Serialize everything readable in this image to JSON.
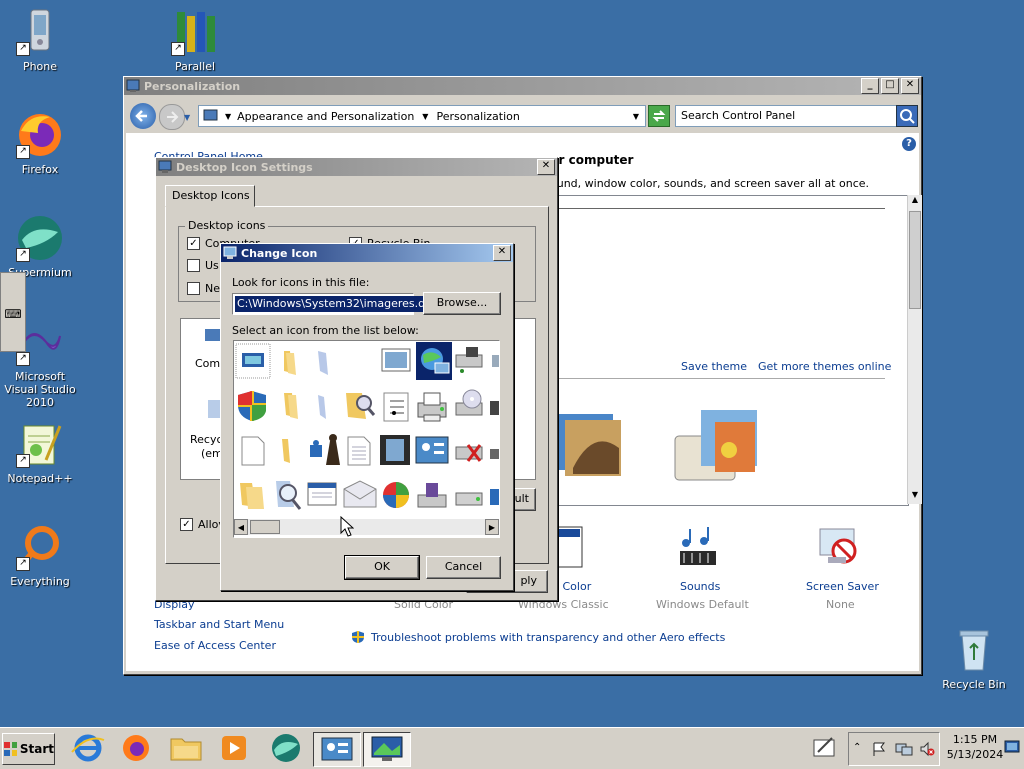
{
  "desktop": {
    "icons": [
      {
        "label": "Phone",
        "icon": "phone-icon"
      },
      {
        "label": "Parallel",
        "icon": "parallel-icon"
      },
      {
        "label": "Firefox",
        "icon": "firefox-icon"
      },
      {
        "label": "Supermium",
        "icon": "supermium-icon"
      },
      {
        "label": "Microsoft Visual Studio 2010",
        "icon": "visual-studio-icon"
      },
      {
        "label": "Notepad++",
        "icon": "notepadpp-icon"
      },
      {
        "label": "Everything",
        "icon": "everything-icon"
      },
      {
        "label": "Recycle Bin",
        "icon": "recycle-bin-icon"
      }
    ]
  },
  "personalization": {
    "title": "Personalization",
    "breadcrumb": [
      "Appearance and Personalization",
      "Personalization"
    ],
    "search_placeholder": "Search Control Panel",
    "sidebar_top": "Control Panel Home",
    "heading": "ur computer",
    "description": "ound, window color, sounds, and screen saver all at once.",
    "save_theme": "Save theme",
    "get_more_themes": "Get more themes online",
    "bottom_items": [
      {
        "label": "w Color",
        "sub": "Windows Classic"
      },
      {
        "label": "Sounds",
        "sub": "Windows Default"
      },
      {
        "label": "Screen Saver",
        "sub": "None"
      }
    ],
    "solid_color": "Solid Color",
    "sidebar_links": [
      "Display",
      "Taskbar and Start Menu",
      "Ease of Access Center"
    ],
    "troubleshoot": "Troubleshoot problems with transparency and other Aero effects"
  },
  "desktop_icon_settings": {
    "title": "Desktop Icon Settings",
    "tab": "Desktop Icons",
    "group_label": "Desktop icons",
    "checks": [
      {
        "label": "Computer",
        "checked": true
      },
      {
        "label": "Us",
        "checked": false
      },
      {
        "label": "Ne",
        "checked": false
      }
    ],
    "recycle_check": {
      "label": "Recycle Bin",
      "checked": true
    },
    "preview_labels": [
      "Comp",
      "Recyc",
      "(emp"
    ],
    "allow_label": "Allov",
    "default_btn": "ault",
    "apply_btn": "ply"
  },
  "change_icon": {
    "title": "Change Icon",
    "file_label": "Look for icons in this file:",
    "file_value": "C:\\Windows\\System32\\imageres.dll",
    "browse": "Browse...",
    "list_label": "Select an icon from the list below:",
    "ok": "OK",
    "cancel": "Cancel"
  },
  "taskbar": {
    "start": "Start",
    "time": "1:15 PM",
    "date": "5/13/2024"
  }
}
